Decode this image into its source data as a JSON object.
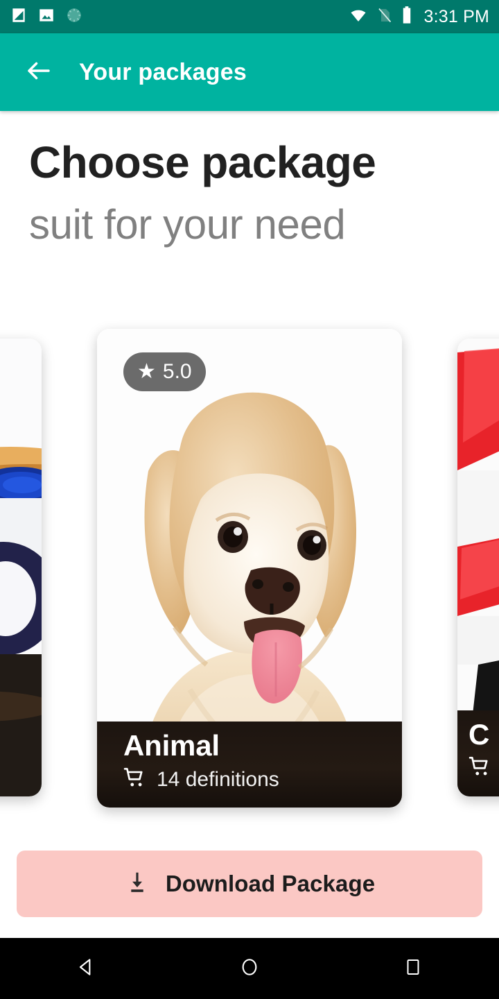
{
  "status_bar": {
    "time": "3:31 PM",
    "background": "#00796B",
    "left_icons": [
      "screenshot-icon",
      "image-icon",
      "sync-progress-icon"
    ],
    "right_icons": [
      "wifi-icon",
      "no-sim-icon",
      "battery-icon"
    ]
  },
  "app_bar": {
    "background": "#00B3A0",
    "back_icon": "arrow-left-icon",
    "title": "Your packages"
  },
  "headings": {
    "title": "Choose package",
    "subtitle": "suit for your need",
    "title_color": "#212121",
    "subtitle_color": "#808080"
  },
  "carousel": {
    "cards": [
      {
        "title": "",
        "meta": "",
        "rating": "",
        "image": "cereal-bowl-photo",
        "position": "left-partial"
      },
      {
        "title": "Animal",
        "meta": "14 definitions",
        "rating": "5.0",
        "rating_star_icon": "star-icon",
        "cart_icon": "shopping-cart-icon",
        "image": "golden-fluffy-dog-photo",
        "position": "center-active"
      },
      {
        "title": "C",
        "meta": "",
        "rating": "",
        "cart_icon": "shopping-cart-icon",
        "image": "red-white-objects-photo",
        "position": "right-partial"
      }
    ]
  },
  "download_button": {
    "label": "Download Package",
    "icon": "download-icon",
    "background": "#FBC8C4",
    "text_color": "#1C1C1C"
  },
  "nav_bar": {
    "background": "#000000",
    "items": [
      {
        "name": "back-triangle-icon"
      },
      {
        "name": "home-circle-icon"
      },
      {
        "name": "recents-square-icon"
      }
    ]
  }
}
